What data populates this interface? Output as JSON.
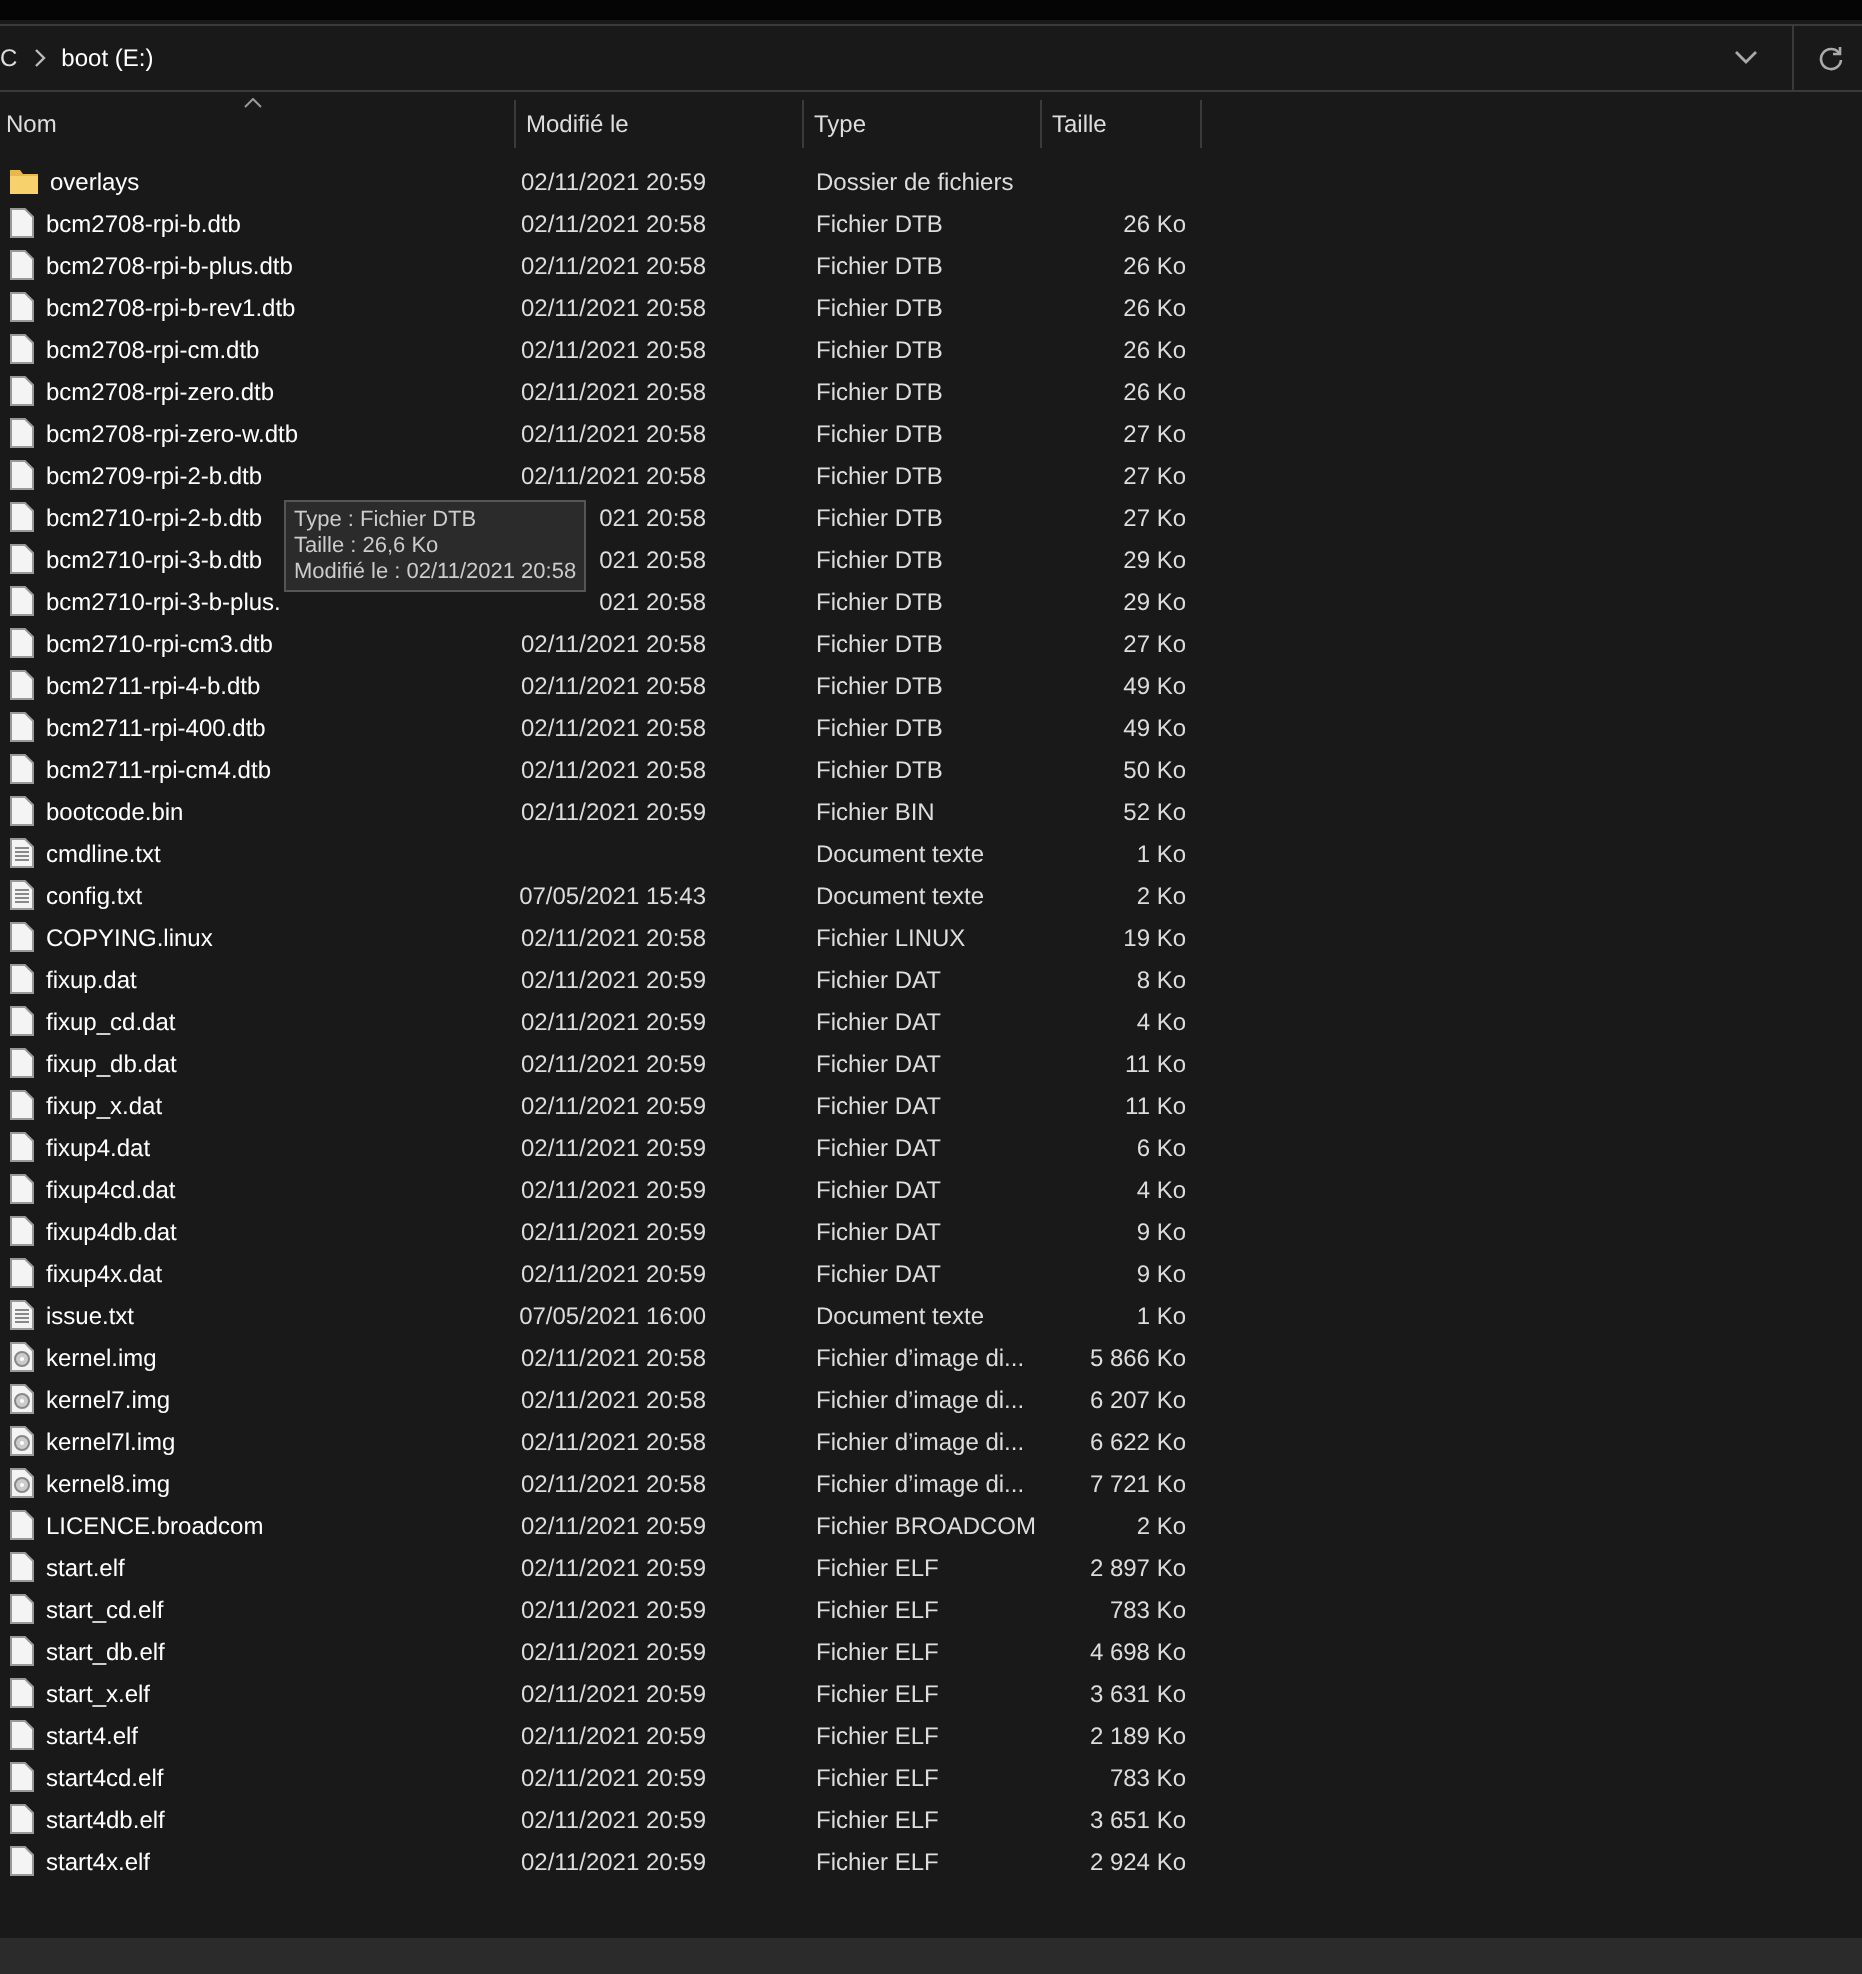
{
  "address_bar": {
    "crumbs": [
      "C",
      "boot (E:)"
    ]
  },
  "columns": [
    {
      "label": "Nom",
      "sorted": true
    },
    {
      "label": "Modifié le",
      "sorted": false
    },
    {
      "label": "Type",
      "sorted": false
    },
    {
      "label": "Taille",
      "sorted": false
    }
  ],
  "rows": [
    {
      "kind": "folder",
      "name": "overlays",
      "modified": "02/11/2021 20:59",
      "type": "Dossier de fichiers"
    },
    {
      "kind": "file",
      "name": "bcm2708-rpi-b.dtb",
      "modified": "02/11/2021 20:58",
      "type": "Fichier DTB",
      "size": "26 Ko"
    },
    {
      "kind": "file",
      "name": "bcm2708-rpi-b-plus.dtb",
      "modified": "02/11/2021 20:58",
      "type": "Fichier DTB",
      "size": "26 Ko"
    },
    {
      "kind": "file",
      "name": "bcm2708-rpi-b-rev1.dtb",
      "modified": "02/11/2021 20:58",
      "type": "Fichier DTB",
      "size": "26 Ko"
    },
    {
      "kind": "file",
      "name": "bcm2708-rpi-cm.dtb",
      "modified": "02/11/2021 20:58",
      "type": "Fichier DTB",
      "size": "26 Ko"
    },
    {
      "kind": "file",
      "name": "bcm2708-rpi-zero.dtb",
      "modified": "02/11/2021 20:58",
      "type": "Fichier DTB",
      "size": "26 Ko"
    },
    {
      "kind": "file",
      "name": "bcm2708-rpi-zero-w.dtb",
      "modified": "02/11/2021 20:58",
      "type": "Fichier DTB",
      "size": "27 Ko"
    },
    {
      "kind": "file",
      "name": "bcm2709-rpi-2-b.dtb",
      "modified": "02/11/2021 20:58",
      "type": "Fichier DTB",
      "size": "27 Ko"
    },
    {
      "kind": "file",
      "name": "bcm2710-rpi-2-b.dtb",
      "modified": "021 20:58",
      "type": "Fichier DTB",
      "size": "27 Ko"
    },
    {
      "kind": "file",
      "name": "bcm2710-rpi-3-b.dtb",
      "modified": "021 20:58",
      "type": "Fichier DTB",
      "size": "29 Ko"
    },
    {
      "kind": "file",
      "name": "bcm2710-rpi-3-b-plus.",
      "modified": "021 20:58",
      "type": "Fichier DTB",
      "size": "29 Ko"
    },
    {
      "kind": "file",
      "name": "bcm2710-rpi-cm3.dtb",
      "modified": "02/11/2021 20:58",
      "type": "Fichier DTB",
      "size": "27 Ko"
    },
    {
      "kind": "file",
      "name": "bcm2711-rpi-4-b.dtb",
      "modified": "02/11/2021 20:58",
      "type": "Fichier DTB",
      "size": "49 Ko"
    },
    {
      "kind": "file",
      "name": "bcm2711-rpi-400.dtb",
      "modified": "02/11/2021 20:58",
      "type": "Fichier DTB",
      "size": "49 Ko"
    },
    {
      "kind": "file",
      "name": "bcm2711-rpi-cm4.dtb",
      "modified": "02/11/2021 20:58",
      "type": "Fichier DTB",
      "size": "50 Ko"
    },
    {
      "kind": "file",
      "name": "bootcode.bin",
      "modified": "02/11/2021 20:59",
      "type": "Fichier BIN",
      "size": "52 Ko"
    },
    {
      "kind": "text",
      "name": "cmdline.txt",
      "type": "Document texte",
      "size": "1 Ko"
    },
    {
      "kind": "text",
      "name": "config.txt",
      "modified": "07/05/2021 15:43",
      "type": "Document texte",
      "size": "2 Ko"
    },
    {
      "kind": "file",
      "name": "COPYING.linux",
      "modified": "02/11/2021 20:58",
      "type": "Fichier LINUX",
      "size": "19 Ko"
    },
    {
      "kind": "file",
      "name": "fixup.dat",
      "modified": "02/11/2021 20:59",
      "type": "Fichier DAT",
      "size": "8 Ko"
    },
    {
      "kind": "file",
      "name": "fixup_cd.dat",
      "modified": "02/11/2021 20:59",
      "type": "Fichier DAT",
      "size": "4 Ko"
    },
    {
      "kind": "file",
      "name": "fixup_db.dat",
      "modified": "02/11/2021 20:59",
      "type": "Fichier DAT",
      "size": "11 Ko"
    },
    {
      "kind": "file",
      "name": "fixup_x.dat",
      "modified": "02/11/2021 20:59",
      "type": "Fichier DAT",
      "size": "11 Ko"
    },
    {
      "kind": "file",
      "name": "fixup4.dat",
      "modified": "02/11/2021 20:59",
      "type": "Fichier DAT",
      "size": "6 Ko"
    },
    {
      "kind": "file",
      "name": "fixup4cd.dat",
      "modified": "02/11/2021 20:59",
      "type": "Fichier DAT",
      "size": "4 Ko"
    },
    {
      "kind": "file",
      "name": "fixup4db.dat",
      "modified": "02/11/2021 20:59",
      "type": "Fichier DAT",
      "size": "9 Ko"
    },
    {
      "kind": "file",
      "name": "fixup4x.dat",
      "modified": "02/11/2021 20:59",
      "type": "Fichier DAT",
      "size": "9 Ko"
    },
    {
      "kind": "text",
      "name": "issue.txt",
      "modified": "07/05/2021 16:00",
      "type": "Document texte",
      "size": "1 Ko"
    },
    {
      "kind": "image",
      "name": "kernel.img",
      "modified": "02/11/2021 20:58",
      "type": "Fichier d’image di...",
      "size": "5 866 Ko"
    },
    {
      "kind": "image",
      "name": "kernel7.img",
      "modified": "02/11/2021 20:58",
      "type": "Fichier d’image di...",
      "size": "6 207 Ko"
    },
    {
      "kind": "image",
      "name": "kernel7l.img",
      "modified": "02/11/2021 20:58",
      "type": "Fichier d’image di...",
      "size": "6 622 Ko"
    },
    {
      "kind": "image",
      "name": "kernel8.img",
      "modified": "02/11/2021 20:58",
      "type": "Fichier d’image di...",
      "size": "7 721 Ko"
    },
    {
      "kind": "file",
      "name": "LICENCE.broadcom",
      "modified": "02/11/2021 20:59",
      "type": "Fichier BROADCOM",
      "size": "2 Ko"
    },
    {
      "kind": "file",
      "name": "start.elf",
      "modified": "02/11/2021 20:59",
      "type": "Fichier ELF",
      "size": "2 897 Ko"
    },
    {
      "kind": "file",
      "name": "start_cd.elf",
      "modified": "02/11/2021 20:59",
      "type": "Fichier ELF",
      "size": "783 Ko"
    },
    {
      "kind": "file",
      "name": "start_db.elf",
      "modified": "02/11/2021 20:59",
      "type": "Fichier ELF",
      "size": "4 698 Ko"
    },
    {
      "kind": "file",
      "name": "start_x.elf",
      "modified": "02/11/2021 20:59",
      "type": "Fichier ELF",
      "size": "3 631 Ko"
    },
    {
      "kind": "file",
      "name": "start4.elf",
      "modified": "02/11/2021 20:59",
      "type": "Fichier ELF",
      "size": "2 189 Ko"
    },
    {
      "kind": "file",
      "name": "start4cd.elf",
      "modified": "02/11/2021 20:59",
      "type": "Fichier ELF",
      "size": "783 Ko"
    },
    {
      "kind": "file",
      "name": "start4db.elf",
      "modified": "02/11/2021 20:59",
      "type": "Fichier ELF",
      "size": "3 651 Ko"
    },
    {
      "kind": "file",
      "name": "start4x.elf",
      "modified": "02/11/2021 20:59",
      "type": "Fichier ELF",
      "size": "2 924 Ko"
    }
  ],
  "tooltip": {
    "lines": [
      "Type : Fichier DTB",
      "Taille : 26,6 Ko",
      "Modifié le : 02/11/2021 20:58"
    ]
  }
}
